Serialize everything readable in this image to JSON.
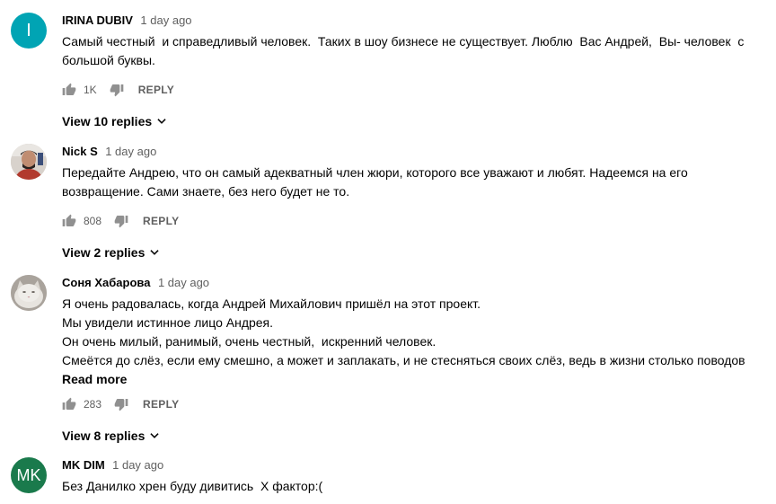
{
  "comments": [
    {
      "author": "IRINA DUBIV",
      "time": "1 day ago",
      "avatar_letter": "I",
      "avatar_color": "#00a4b4",
      "text": "Самый честный  и справедливый человек.  Таких в шоу бизнесе не существует. Люблю  Вас Андрей,  Вы- человек  с большой буквы.",
      "likes": "1K",
      "reply_label": "REPLY",
      "view_replies": "View 10 replies"
    },
    {
      "author": "Nick S",
      "time": "1 day ago",
      "avatar_icon": "user-photo-avatar",
      "text": "Передайте Андрею, что он самый адекватный член жюри, которого все уважают и любят. Надеемся на его возвращение. Сами знаете, без него будет не то.",
      "likes": "808",
      "reply_label": "REPLY",
      "view_replies": "View 2 replies"
    },
    {
      "author": "Соня Хабарова",
      "time": "1 day ago",
      "avatar_icon": "cat-photo-avatar",
      "text": "Я очень радовалась, когда Андрей Михайлович пришёл на этот проект.\nМы увидели истинное лицо Андрея.\nОн очень милый, ранимый, очень честный,  искренний человек.\nСмеётся до слёз, если ему смешно, а может и заплакать, и не стесняться своих слёз, ведь в жизни столько поводов",
      "read_more": "Read more",
      "likes": "283",
      "reply_label": "REPLY",
      "view_replies": "View 8 replies"
    },
    {
      "author": "MK DIM",
      "time": "1 day ago",
      "avatar_letter": "MK",
      "avatar_color": "#1a7a4c",
      "text": "Без Данилко хрен буду дивитись  Х фактор:("
    }
  ]
}
